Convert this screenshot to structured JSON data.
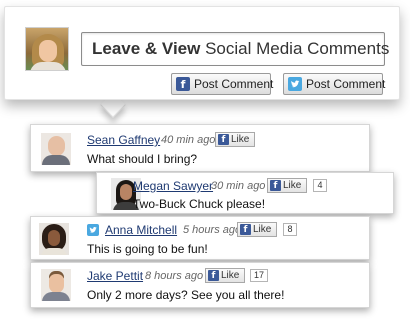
{
  "composer": {
    "title_bold": "Leave & View",
    "title_rest": " Social Media Comments",
    "facebook_button": "Post Comment",
    "twitter_button": "Post Comment",
    "facebook_icon": "f"
  },
  "like_label": "Like",
  "comments": [
    {
      "name": "Sean Gaffney",
      "time": "40 min ago",
      "text": "What should I bring?",
      "source": "facebook",
      "likes": ""
    },
    {
      "name": "Megan Sawyer",
      "time": "30 min ago",
      "text": "Two-Buck Chuck please!",
      "source": "facebook",
      "likes": "4"
    },
    {
      "name": "Anna Mitchell",
      "time": "5 hours ago",
      "text": "This is going to be fun!",
      "source": "twitter",
      "likes": "8"
    },
    {
      "name": "Jake Pettit",
      "time": "8 hours ago",
      "text": "Only 2 more days? See you all there!",
      "source": "facebook",
      "likes": "17"
    }
  ],
  "colors": {
    "facebook": "#3b5998",
    "twitter": "#4aa8e0",
    "name_link": "#1f3a72"
  }
}
